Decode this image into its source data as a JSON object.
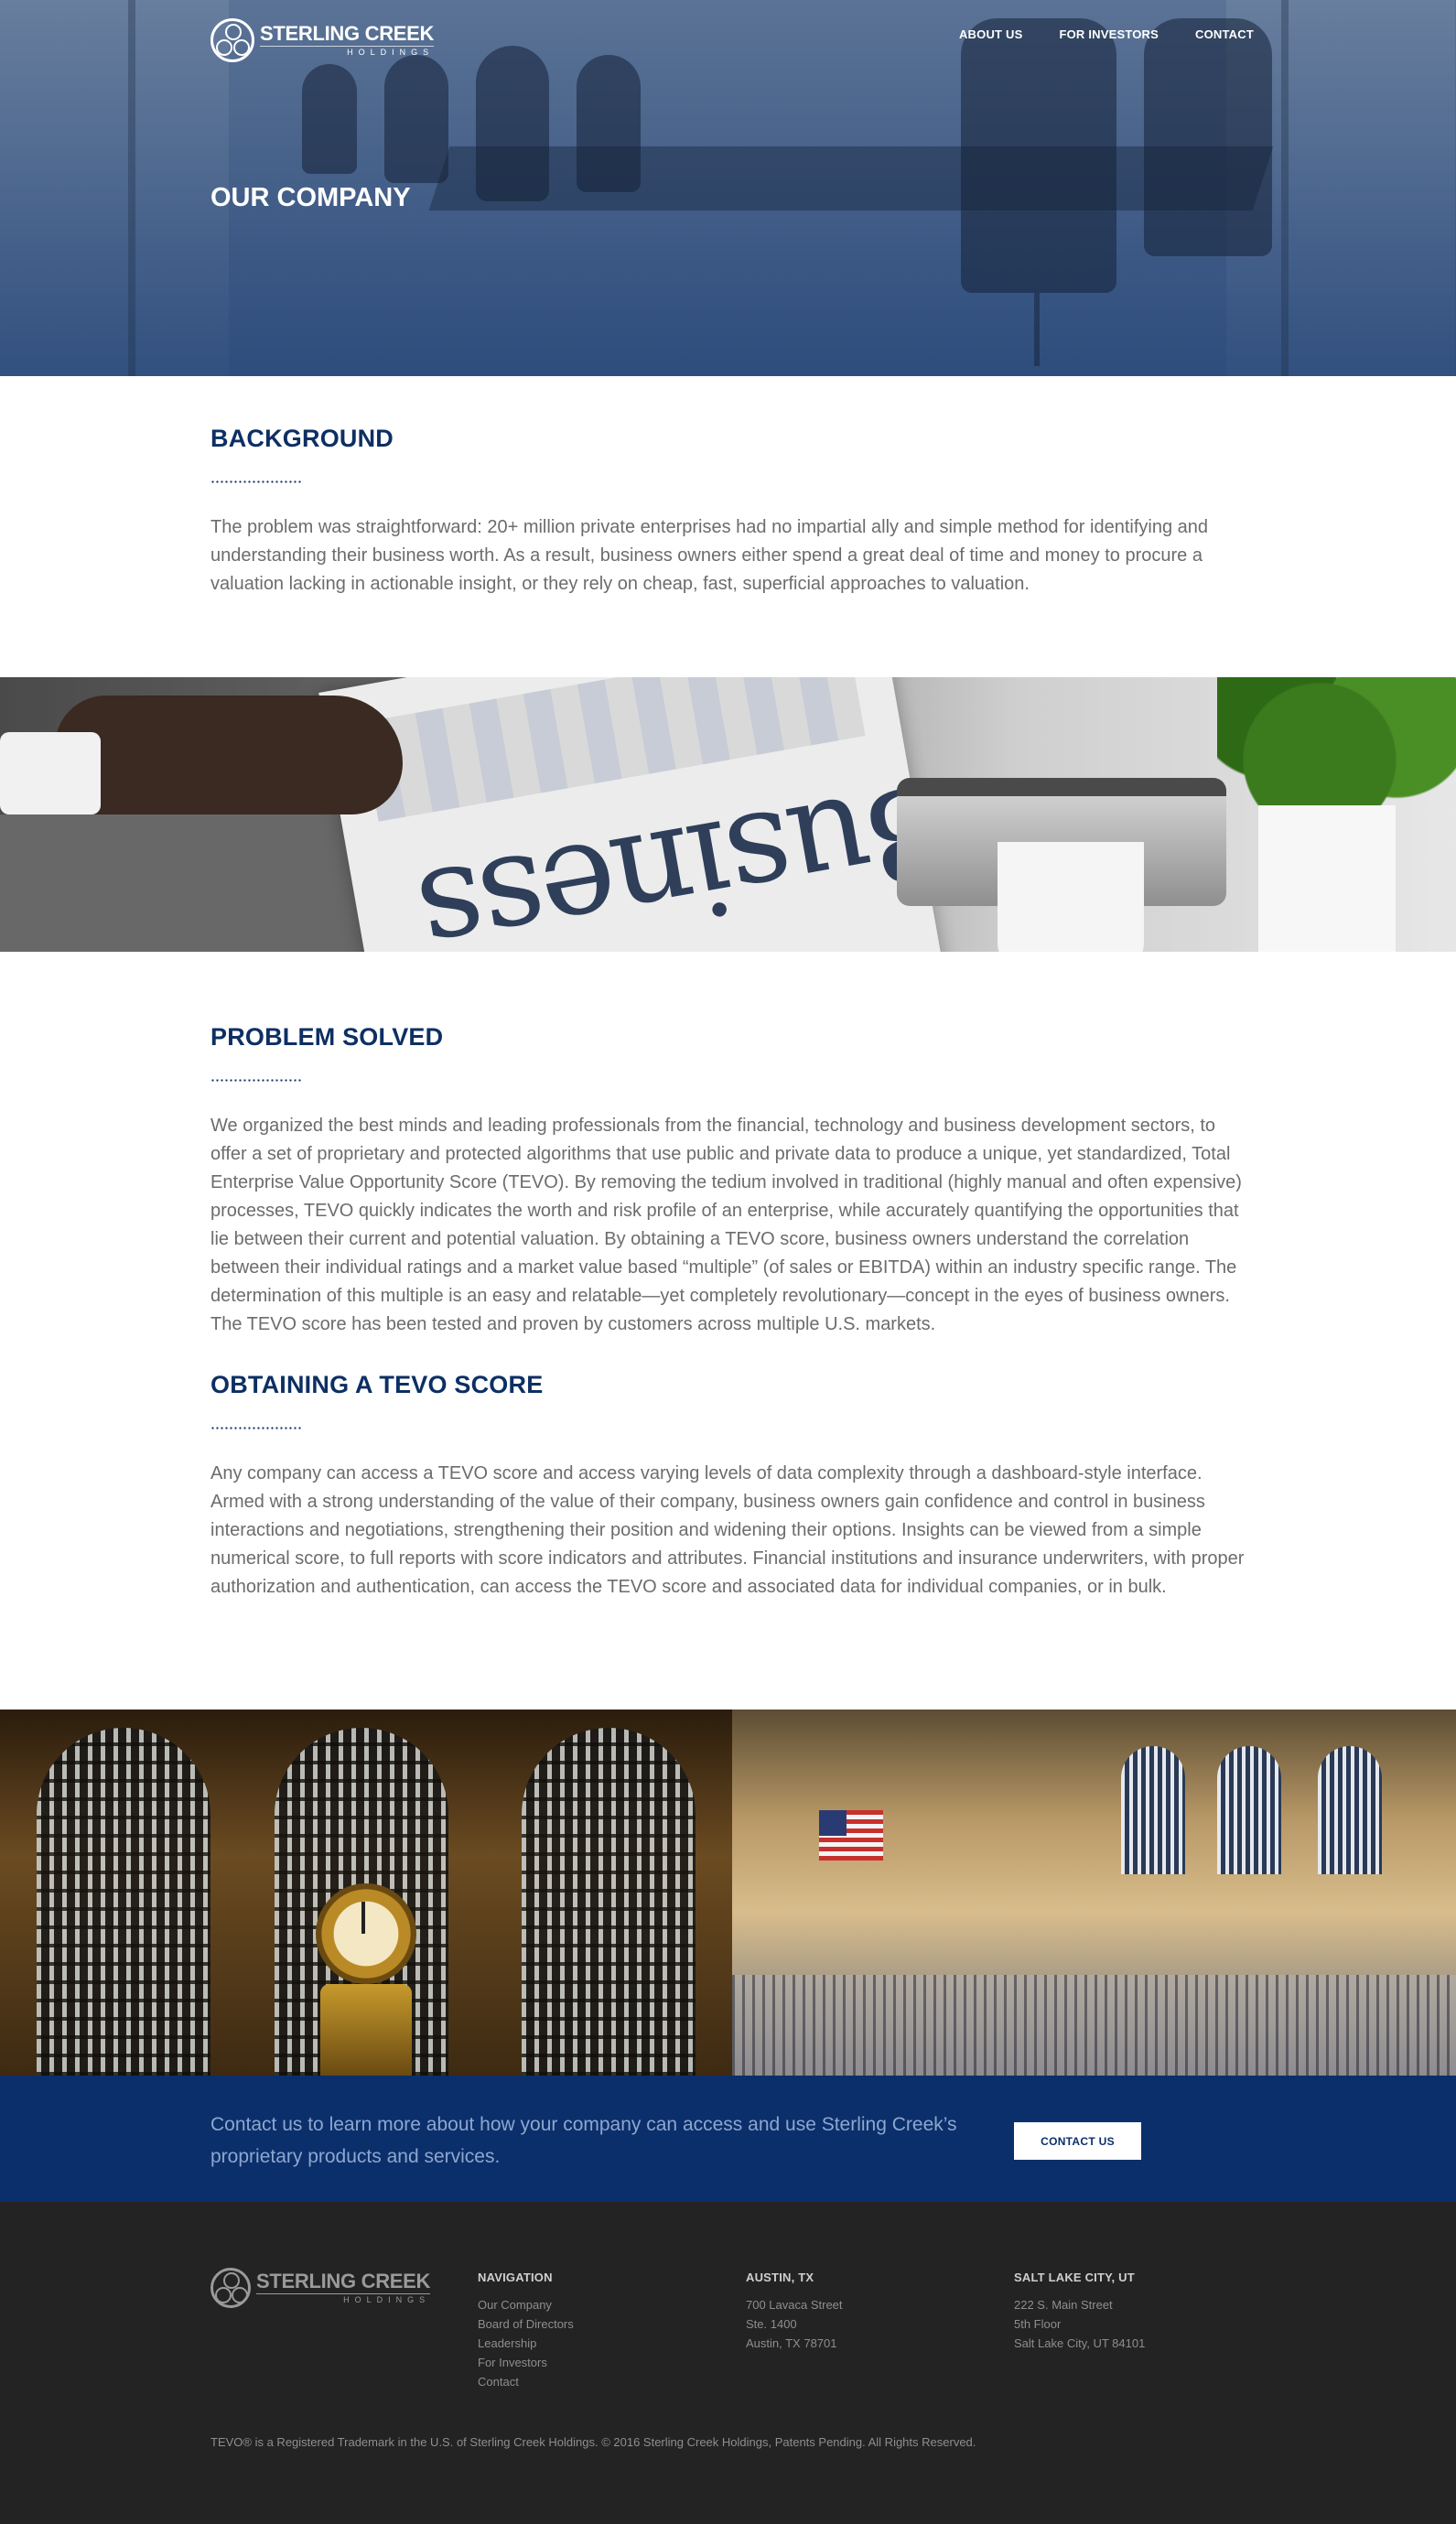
{
  "header": {
    "logo_name": "STERLING CREEK",
    "logo_sub": "HOLDINGS",
    "nav": [
      "ABOUT US",
      "FOR INVESTORS",
      "CONTACT"
    ],
    "hero_title": "OUR COMPANY"
  },
  "background": {
    "title": "BACKGROUND",
    "text": "The problem was straightforward: 20+ million private enterprises had no impartial ally and simple method for identifying and understanding their business worth. As a result, business owners either spend a great deal of time and money to procure a valuation lacking in actionable insight, or they rely on cheap, fast, superficial approaches to valuation."
  },
  "problem": {
    "title": "PROBLEM SOLVED",
    "text": "We organized the best minds and leading professionals from the financial, technology and business development sectors, to offer a set of proprietary and protected algorithms that use public and private data to produce a unique, yet standardized, Total Enterprise Value Opportunity Score (TEVO). By removing the tedium involved in traditional (highly manual and often expensive) processes, TEVO quickly indicates the worth and risk profile of an enterprise, while accurately quantifying the opportunities that lie between their current and potential valuation. By obtaining a TEVO score, business owners understand the correlation between their individual ratings and a market value based “multiple” (of sales or EBITDA) within an industry specific range. The determination of this multiple is an easy and relatable—yet completely revolutionary—concept in the eyes of business owners. The TEVO score has been tested and proven by customers across multiple U.S. markets."
  },
  "obtaining": {
    "title": "OBTAINING A TEVO SCORE",
    "text": "Any company can access a TEVO score and access varying levels of data complexity through a dashboard-style interface. Armed with a strong understanding of the value of their company, business owners gain confidence and control in business interactions and negotiations, strengthening their position and widening their options. Insights can be viewed from a simple numerical score, to full reports with score indicators and attributes. Financial institutions and insurance underwriters, with proper authorization and authentication, can access the TEVO score and associated data for individual companies, or in bulk."
  },
  "images": {
    "newspaper_word": "Business"
  },
  "cta": {
    "text": "Contact us to learn more about how your company can access and use Sterling Creek’s proprietary products and services.",
    "button": "CONTACT US"
  },
  "footer": {
    "navigation": {
      "title": "NAVIGATION",
      "links": [
        "Our Company",
        "Board of Directors",
        "Leadership",
        "For Investors",
        "Contact"
      ]
    },
    "austin": {
      "title": "AUSTIN, TX",
      "lines": [
        "700 Lavaca Street",
        "Ste. 1400",
        "Austin, TX 78701"
      ]
    },
    "slc": {
      "title": "SALT LAKE CITY, UT",
      "lines": [
        "222 S. Main Street",
        "5th Floor",
        "Salt Lake City, UT 84101"
      ]
    },
    "copyright": "TEVO® is a Registered Trademark in the U.S. of Sterling Creek Holdings. © 2016 Sterling Creek Holdings, Patents Pending. All Rights Reserved."
  },
  "colors": {
    "brand_navy": "#0d2f63",
    "cta_bg": "#0b2f6b",
    "footer_bg": "#232323"
  }
}
